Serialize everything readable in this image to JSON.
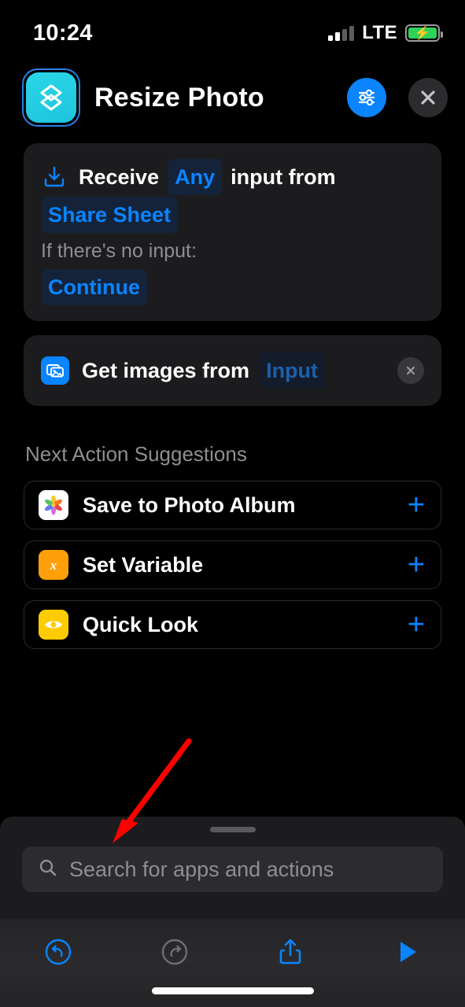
{
  "status_bar": {
    "time": "10:24",
    "carrier": "LTE",
    "signal_bars_filled": 2,
    "signal_bars_total": 4,
    "battery_charging": true,
    "battery_color": "#30d158"
  },
  "header": {
    "title": "Resize Photo",
    "app_icon_name": "shortcut-layers-icon",
    "app_icon_color": "#2ad6e8",
    "settings_button_name": "shortcut-details-button",
    "settings_button_color": "#0a84ff",
    "close_button_name": "close-button"
  },
  "actions": [
    {
      "id": "receive-input",
      "icon": "receive-input-icon",
      "segments": [
        {
          "type": "text",
          "value": "Receive"
        },
        {
          "type": "token",
          "value": "Any"
        },
        {
          "type": "text",
          "value": "input from"
        },
        {
          "type": "token",
          "value": "Share Sheet"
        }
      ],
      "subtitle": "If there's no input:",
      "fallback_token": "Continue"
    },
    {
      "id": "get-images",
      "icon": "photos-stack-icon",
      "icon_color": "#0a84ff",
      "text": "Get images from",
      "token": "Input",
      "token_style": "dim",
      "delete_button": "remove-action-button"
    }
  ],
  "suggestions": {
    "title": "Next Action Suggestions",
    "items": [
      {
        "label": "Save to Photo Album",
        "icon": "photos-app-icon",
        "icon_color": "#ffffff",
        "add_button": "add-action-button"
      },
      {
        "label": "Set Variable",
        "icon": "set-variable-icon",
        "icon_color": "#ff9f0a",
        "add_button": "add-action-button"
      },
      {
        "label": "Quick Look",
        "icon": "quick-look-eye-icon",
        "icon_color": "#ffcc00",
        "add_button": "add-action-button"
      }
    ]
  },
  "search": {
    "placeholder": "Search for apps and actions",
    "icon": "search-icon"
  },
  "toolbar": {
    "undo": {
      "name": "undo-button",
      "enabled": true,
      "color": "#0a84ff"
    },
    "redo": {
      "name": "redo-button",
      "enabled": false,
      "color": "#6e6e73"
    },
    "share": {
      "name": "share-button",
      "color": "#0a84ff"
    },
    "run": {
      "name": "run-button",
      "color": "#0a84ff"
    }
  },
  "annotation": {
    "type": "arrow",
    "color": "#ff0000",
    "points_to": "search-input"
  }
}
